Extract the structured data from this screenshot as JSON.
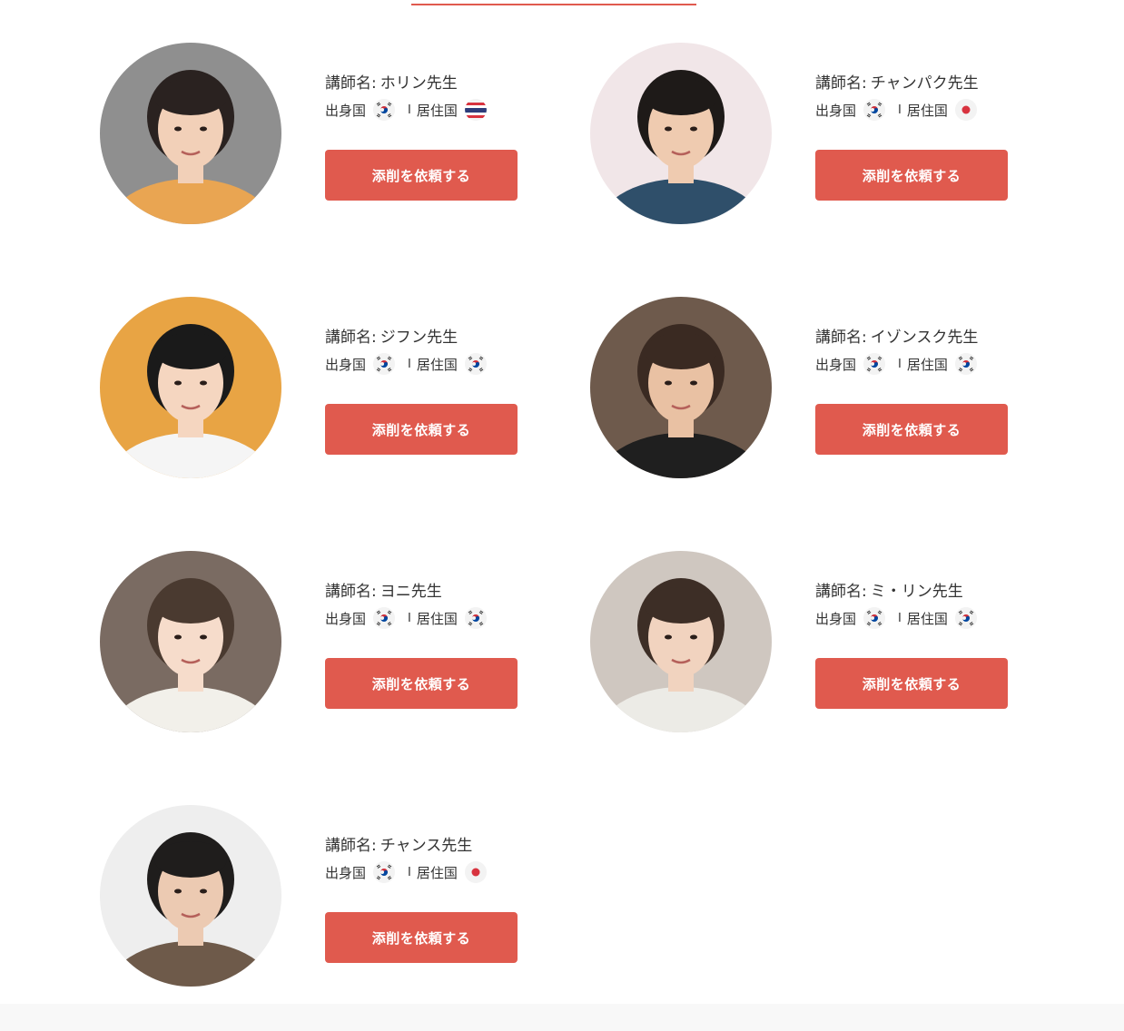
{
  "labels": {
    "name_prefix": "講師名:",
    "origin": "出身国",
    "residence": "居住国",
    "separator": "I",
    "button": "添削を依頼する"
  },
  "colors": {
    "accent": "#e05a4e",
    "button_text": "#ffffff"
  },
  "teachers": [
    {
      "name": "ホリン先生",
      "origin_flag": "korea-flag-icon",
      "residence_flag": "thailand-flag-icon",
      "avatar_bg": "#8f8f8f"
    },
    {
      "name": "チャンパク先生",
      "origin_flag": "korea-flag-icon",
      "residence_flag": "japan-flag-icon",
      "avatar_bg": "#f1e6e8"
    },
    {
      "name": "ジフン先生",
      "origin_flag": "korea-flag-icon",
      "residence_flag": "korea-flag-icon",
      "avatar_bg": "#e8a444"
    },
    {
      "name": "イゾンスク先生",
      "origin_flag": "korea-flag-icon",
      "residence_flag": "korea-flag-icon",
      "avatar_bg": "#6e5a4c"
    },
    {
      "name": "ヨニ先生",
      "origin_flag": "korea-flag-icon",
      "residence_flag": "korea-flag-icon",
      "avatar_bg": "#7a6b62"
    },
    {
      "name": "ミ・リン先生",
      "origin_flag": "korea-flag-icon",
      "residence_flag": "korea-flag-icon",
      "avatar_bg": "#cfc7c0"
    },
    {
      "name": "チャンス先生",
      "origin_flag": "korea-flag-icon",
      "residence_flag": "japan-flag-icon",
      "avatar_bg": "#eeeeee"
    }
  ]
}
